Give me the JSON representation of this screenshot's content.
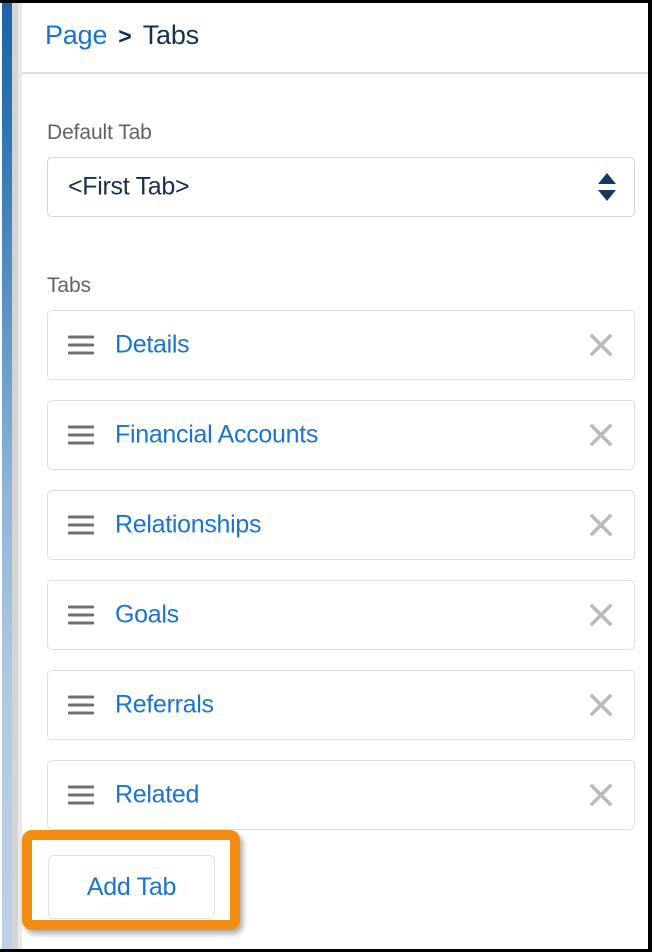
{
  "window": {
    "edge_color": "#000000",
    "rail_top_color": "#1b63a6",
    "rail_bottom_color": "#bdd1e6"
  },
  "header": {
    "breadcrumb": {
      "parent_label": "Page",
      "separator": ">",
      "current_label": "Tabs",
      "link_color": "#1a74cf",
      "current_color": "#14304f"
    }
  },
  "main": {
    "default_tab": {
      "label": "Default Tab",
      "value": "<First Tab>",
      "spinner_up_icon": "triangle-up-icon",
      "spinner_down_icon": "triangle-down-icon"
    },
    "tabs_section": {
      "label": "Tabs",
      "drag_handle_icon": "drag-handle-icon",
      "remove_icon": "close-icon",
      "items": [
        {
          "label": "Details"
        },
        {
          "label": "Financial Accounts"
        },
        {
          "label": "Relationships"
        },
        {
          "label": "Goals"
        },
        {
          "label": "Referrals"
        },
        {
          "label": "Related"
        }
      ]
    },
    "add_tab": {
      "label": "Add Tab",
      "text_color": "#1a74cf"
    }
  },
  "annotation": {
    "highlight_target": "add-tab-button",
    "color": "#f28c12"
  }
}
